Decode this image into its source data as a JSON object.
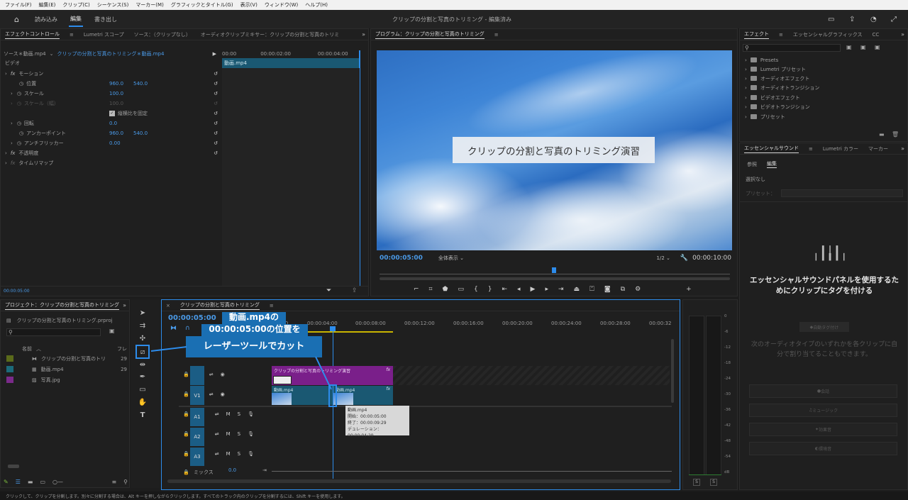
{
  "menu": [
    "ファイル(F)",
    "編集(E)",
    "クリップ(C)",
    "シーケンス(S)",
    "マーカー(M)",
    "グラフィックとタイトル(G)",
    "表示(V)",
    "ウィンドウ(W)",
    "ヘルプ(H)"
  ],
  "workspace": {
    "tabs": [
      "読み込み",
      "編集",
      "書き出し"
    ],
    "active": 1,
    "title": "クリップの分割と写真のトリミング - 編集済み"
  },
  "effect_controls": {
    "tabs": [
      "エフェクトコントロール",
      "Lumetri スコープ",
      "ソース：（クリップなし）",
      "オーディオクリップミキサー：クリップの分割と写真のトリミ"
    ],
    "source": "ソース＊動画.mp4",
    "sequence": "クリップの分割と写真のトリミング＊動画.mp4",
    "ruler": [
      "00:00",
      "00:00:02:00",
      "00:00:04:00"
    ],
    "clip_label": "動画.mp4",
    "video_label": "ビデオ",
    "motion": "モーション",
    "params": [
      {
        "name": "位置",
        "v1": "960.0",
        "v2": "540.0"
      },
      {
        "name": "スケール",
        "v1": "100.0",
        "v2": ""
      },
      {
        "name": "スケール（幅）",
        "v1": "100.0",
        "v2": ""
      },
      {
        "name": "縦横比を固定",
        "v1": "",
        "v2": ""
      },
      {
        "name": "回転",
        "v1": "0.0",
        "v2": ""
      },
      {
        "name": "アンカーポイント",
        "v1": "960.0",
        "v2": "540.0"
      },
      {
        "name": "アンチフリッカー",
        "v1": "0.00",
        "v2": ""
      }
    ],
    "opacity": "不透明度",
    "timeremap": "タイムリマップ",
    "footer_time": "00:00:05:00"
  },
  "program": {
    "title": "プログラム：クリップの分割と写真のトリミング",
    "overlay_text": "クリップの分割と写真のトリミング演習",
    "timecode": "00:00:05:00",
    "fit": "全体表示",
    "quality": "1/2",
    "duration": "00:00:10:00"
  },
  "effects_panel": {
    "tabs": [
      "エフェクト",
      "エッセンシャルグラフィックス",
      "CC"
    ],
    "items": [
      "Presets",
      "Lumetri プリセット",
      "オーディオエフェクト",
      "オーディオトランジション",
      "ビデオエフェクト",
      "ビデオトランジション",
      "プリセット"
    ]
  },
  "essential_sound": {
    "tabs": [
      "エッセンシャルサウンド",
      "Lumetri カラー",
      "マーカー"
    ],
    "subtabs": [
      "参照",
      "編集"
    ],
    "no_selection": "選択なし",
    "preset_label": "プリセット：",
    "message": "エッセンシャルサウンドパネルを使用するためにクリップにタグを付ける",
    "tag_button": "自動タグ付け",
    "hint": "次のオーディオタイプのいずれかを各クリップに自分で割り当てることもできます。",
    "types": [
      "会話",
      "ミュージック",
      "効果音",
      "環境音"
    ]
  },
  "project": {
    "title": "プロジェクト：クリップの分割と写真のトリミング",
    "file": "クリップの分割と写真のトリミング.prproj",
    "col_name": "名前",
    "col_fr": "フレ",
    "items": [
      {
        "name": "クリップの分割と写真のトリ",
        "fr": "29",
        "color": "#5a6a1a"
      },
      {
        "name": "動画.mp4",
        "fr": "29",
        "color": "#1b6a7a"
      },
      {
        "name": "写真.jpg",
        "fr": "",
        "color": "#7a2a8a"
      }
    ]
  },
  "timeline": {
    "title": "クリップの分割と写真のトリミング",
    "timecode": "00:00:05:00",
    "ruler": [
      "00:00",
      "00:00:04:00",
      "00:00:08:00",
      "00:00:12:00",
      "00:00:16:00",
      "00:00:20:00",
      "00:00:24:00",
      "00:00:28:00",
      "00:00:32"
    ],
    "tracks": [
      "V1",
      "A1",
      "A2",
      "A3"
    ],
    "title_clip": "クリップの分割と写真のトリミング演習",
    "clip_a": "動画.mp4",
    "clip_b": "動画.mp4",
    "mix_label": "ミックス",
    "mix_value": "0.0",
    "tooltip": [
      "動画.mp4",
      "開始：00:00:05:00",
      "終了：00:00:09:29",
      "デュレーション：00:00:04:29"
    ],
    "meter_scale": [
      "0",
      "-6",
      "-12",
      "-18",
      "-24",
      "-30",
      "-36",
      "-42",
      "-48",
      "-54",
      "dB"
    ]
  },
  "callout": {
    "lines": [
      "動画.mp4の",
      "00:00:05:00の位置を",
      "レーザーツールでカット"
    ]
  },
  "status": "クリックして、クリップを分割します。別々に分割する場合は、Alt キーを押しながらクリックします。すべてのトラック内のクリップを分割するには、Shift キーを使用します。"
}
